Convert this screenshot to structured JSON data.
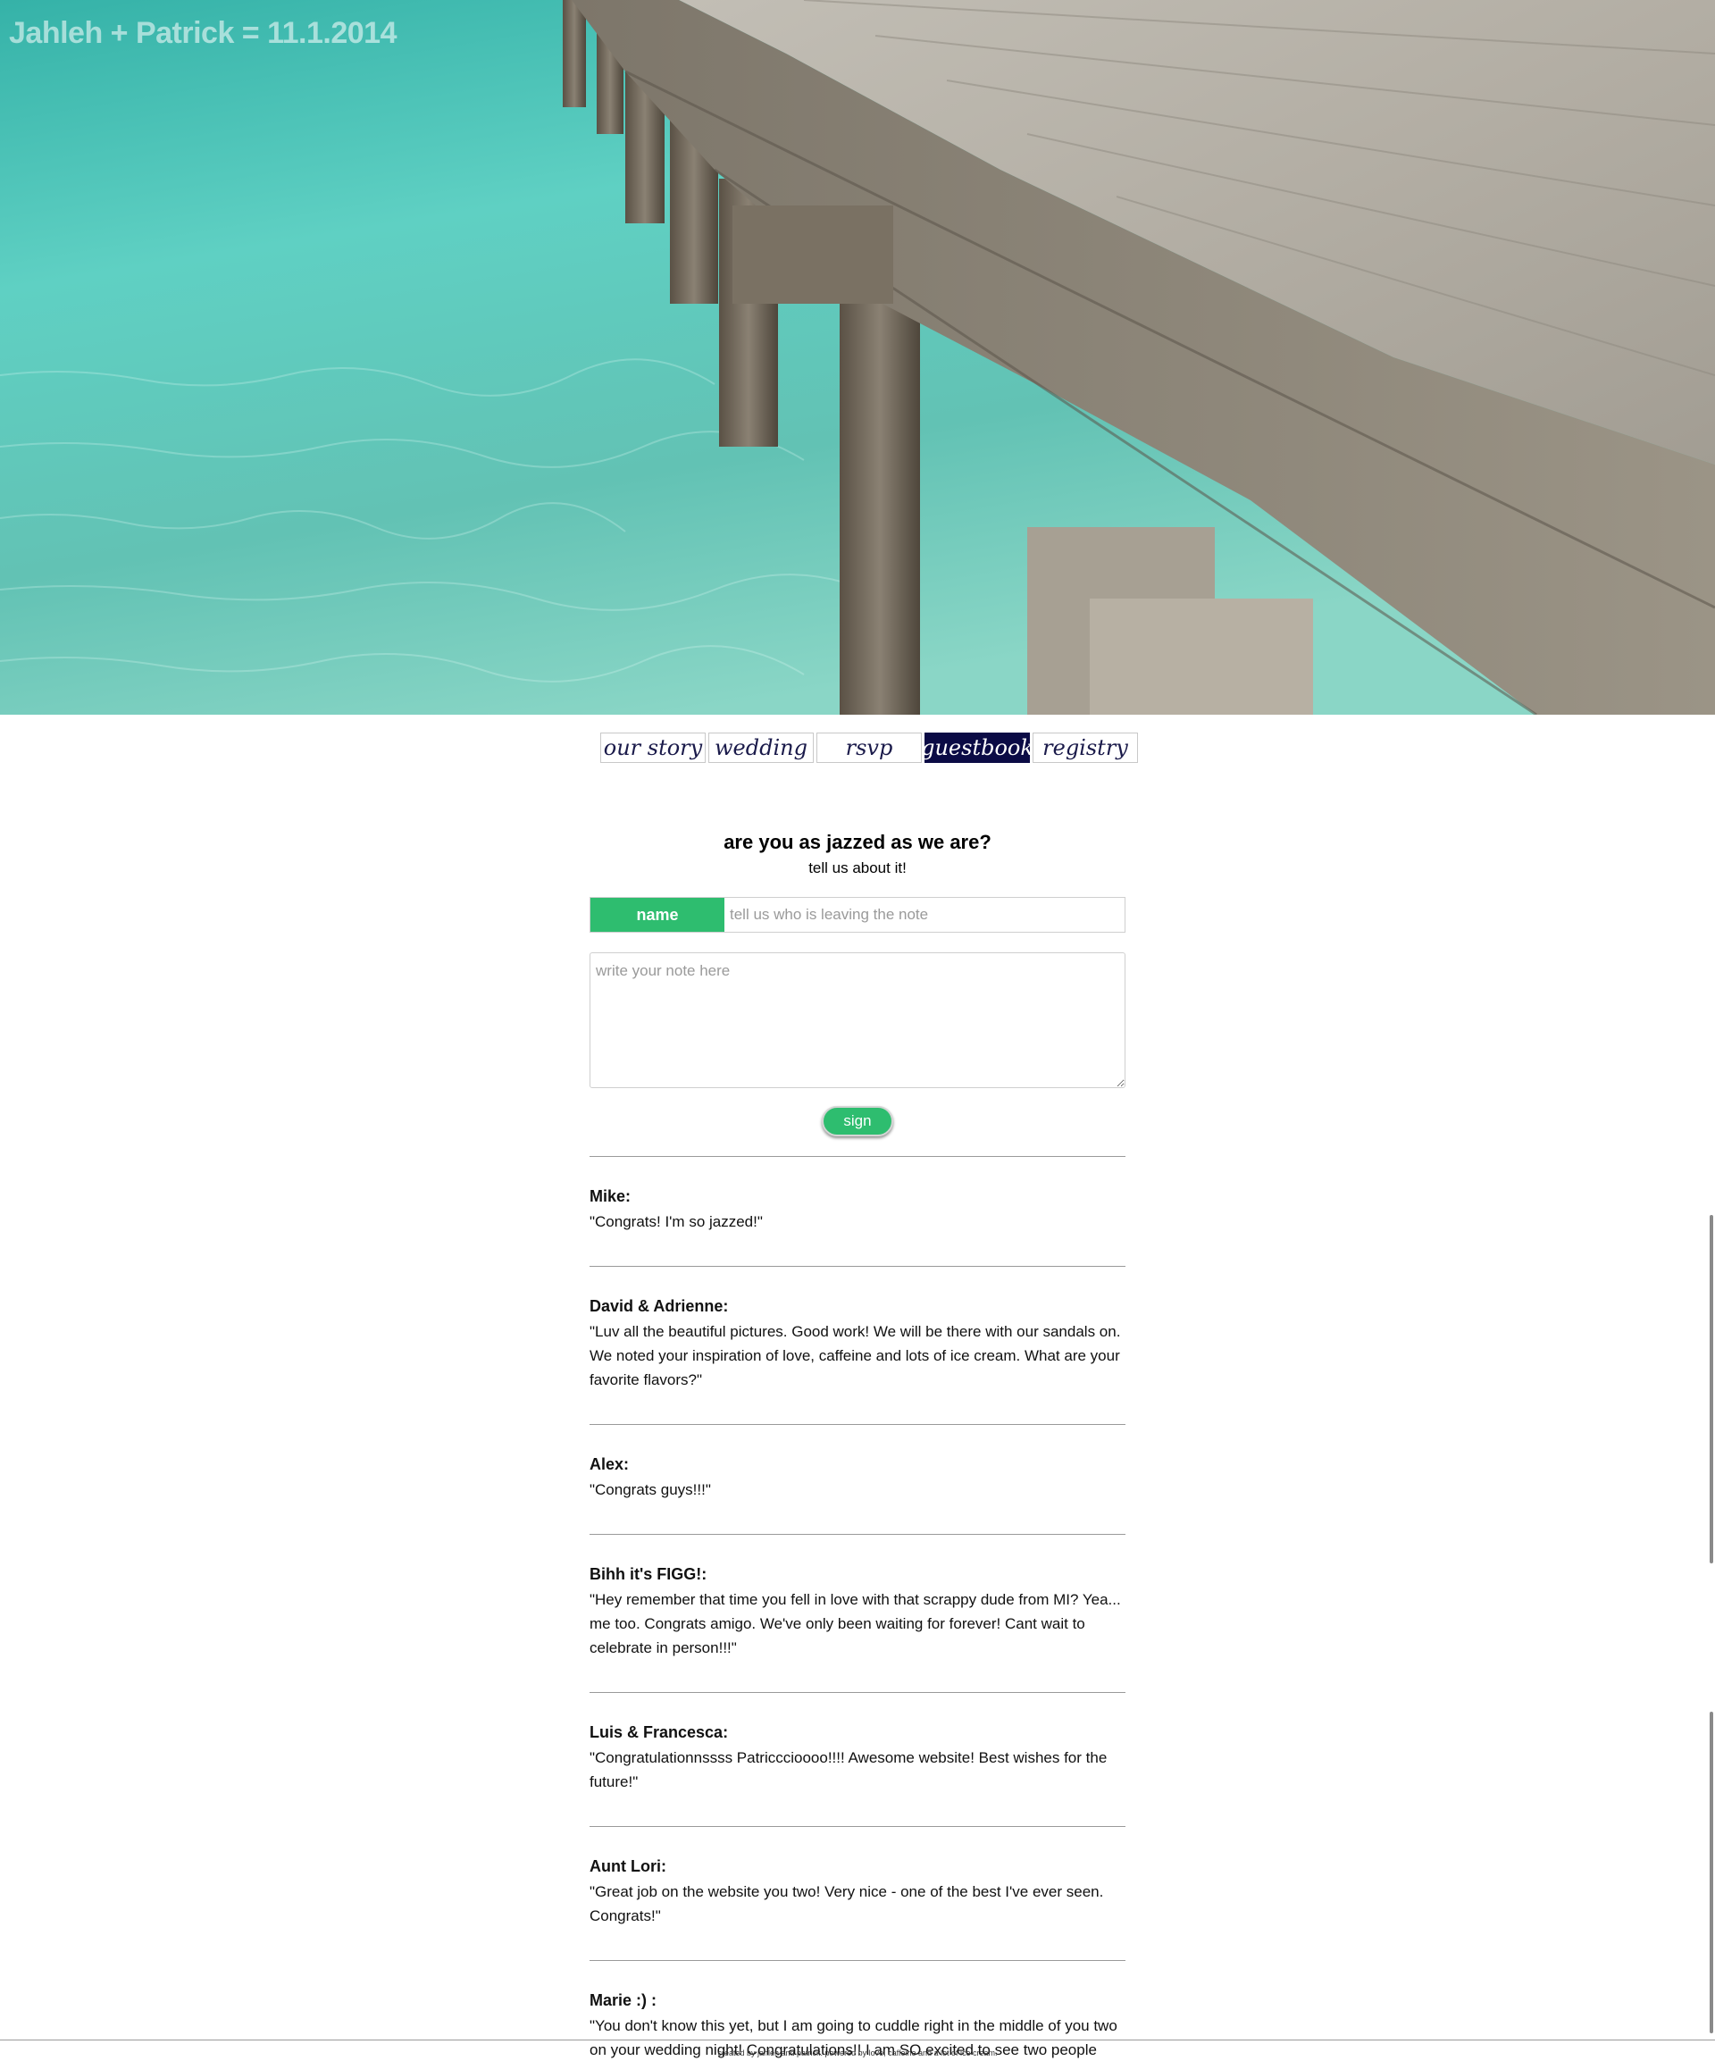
{
  "site": {
    "title": "Jahleh + Patrick = 11.1.2014"
  },
  "hero": {
    "image_alt": "wooden pier over turquoise water"
  },
  "nav": {
    "items": [
      {
        "label": "our story",
        "active": false
      },
      {
        "label": "wedding",
        "active": false
      },
      {
        "label": "rsvp",
        "active": false
      },
      {
        "label": "guestbook",
        "active": true
      },
      {
        "label": "registry",
        "active": false
      }
    ]
  },
  "guestbook": {
    "heading": "are you as jazzed as we are?",
    "subheading": "tell us about it!",
    "name_label": "name",
    "name_placeholder": "tell us who is leaving the note",
    "name_value": "",
    "note_placeholder": "write your note here",
    "note_value": "",
    "sign_label": "sign",
    "entries": [
      {
        "name": "Mike:",
        "text": "\"Congrats! I'm so jazzed!\""
      },
      {
        "name": "David & Adrienne:",
        "text": "\"Luv all the beautiful pictures. Good work! We will be there with our sandals on. We noted your inspiration of love, caffeine and lots of ice cream. What are your favorite flavors?\""
      },
      {
        "name": "Alex:",
        "text": "\"Congrats guys!!!\""
      },
      {
        "name": "Bihh it's FIGG!:",
        "text": "\"Hey remember that time you fell in love with that scrappy dude from MI? Yea... me too. Congrats amigo. We've only been waiting for forever! Cant wait to celebrate in person!!!\""
      },
      {
        "name": "Luis & Francesca:",
        "text": "\"Congratulationnssss Patricccioooo!!!! Awesome website! Best wishes for the future!\""
      },
      {
        "name": "Aunt Lori:",
        "text": "\"Great job on the website you two! Very nice - one of the best I've ever seen. Congrats!\""
      },
      {
        "name": "Marie :) :",
        "text": "\"You don't know this yet, but I am going to cuddle right in the middle of you two on your wedding night! Congratulations!! I am SO excited to see two people (who are beyond perfect for each other) say \"I do.\" Love you both. Cheers! :)\""
      }
    ]
  },
  "footer": {
    "text": "created by jahleh and patrick. powered by love, caffeine and a lot of ice cream."
  },
  "colors": {
    "accent_green": "#2ebd6f",
    "nav_active": "#0b0b45",
    "water": "#56c6b9",
    "wood": "#9c9890"
  }
}
